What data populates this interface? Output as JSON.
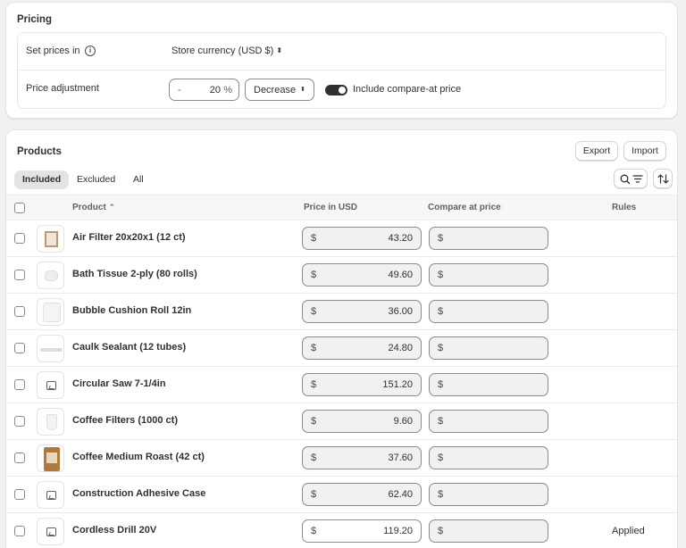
{
  "pricing": {
    "title": "Pricing",
    "set_prices_label": "Set prices in",
    "currency_value": "Store currency (USD $)",
    "adjustment_label": "Price adjustment",
    "adjust_sign": "-",
    "adjust_value": "20",
    "adjust_unit": "%",
    "direction_value": "Decrease",
    "include_compare_label": "Include compare-at price",
    "include_compare_on": true
  },
  "products": {
    "title": "Products",
    "export_label": "Export",
    "import_label": "Import",
    "tabs": [
      {
        "label": "Included",
        "active": true
      },
      {
        "label": "Excluded",
        "active": false
      },
      {
        "label": "All",
        "active": false
      }
    ],
    "columns": {
      "product": "Product",
      "price": "Price in USD",
      "compare": "Compare at price",
      "rules": "Rules"
    },
    "currency_symbol": "$",
    "rows": [
      {
        "name": "Air Filter 20x20x1 (12 ct)",
        "price": "43.20",
        "compare": "",
        "rule": "",
        "thumb": "filter"
      },
      {
        "name": "Bath Tissue 2-ply (80 rolls)",
        "price": "49.60",
        "compare": "",
        "rule": "",
        "thumb": "tissue"
      },
      {
        "name": "Bubble Cushion Roll 12in",
        "price": "36.00",
        "compare": "",
        "rule": "",
        "thumb": "bubble"
      },
      {
        "name": "Caulk Sealant (12 tubes)",
        "price": "24.80",
        "compare": "",
        "rule": "",
        "thumb": "caulk"
      },
      {
        "name": "Circular Saw 7-1/4in",
        "price": "151.20",
        "compare": "",
        "rule": "",
        "thumb": "placeholder"
      },
      {
        "name": "Coffee Filters (1000 ct)",
        "price": "9.60",
        "compare": "",
        "rule": "",
        "thumb": "cup"
      },
      {
        "name": "Coffee Medium Roast (42 ct)",
        "price": "37.60",
        "compare": "",
        "rule": "",
        "thumb": "bag"
      },
      {
        "name": "Construction Adhesive Case",
        "price": "62.40",
        "compare": "",
        "rule": "",
        "thumb": "placeholder"
      },
      {
        "name": "Cordless Drill 20V",
        "price": "119.20",
        "compare": "",
        "rule": "Applied",
        "thumb": "placeholder"
      }
    ]
  }
}
